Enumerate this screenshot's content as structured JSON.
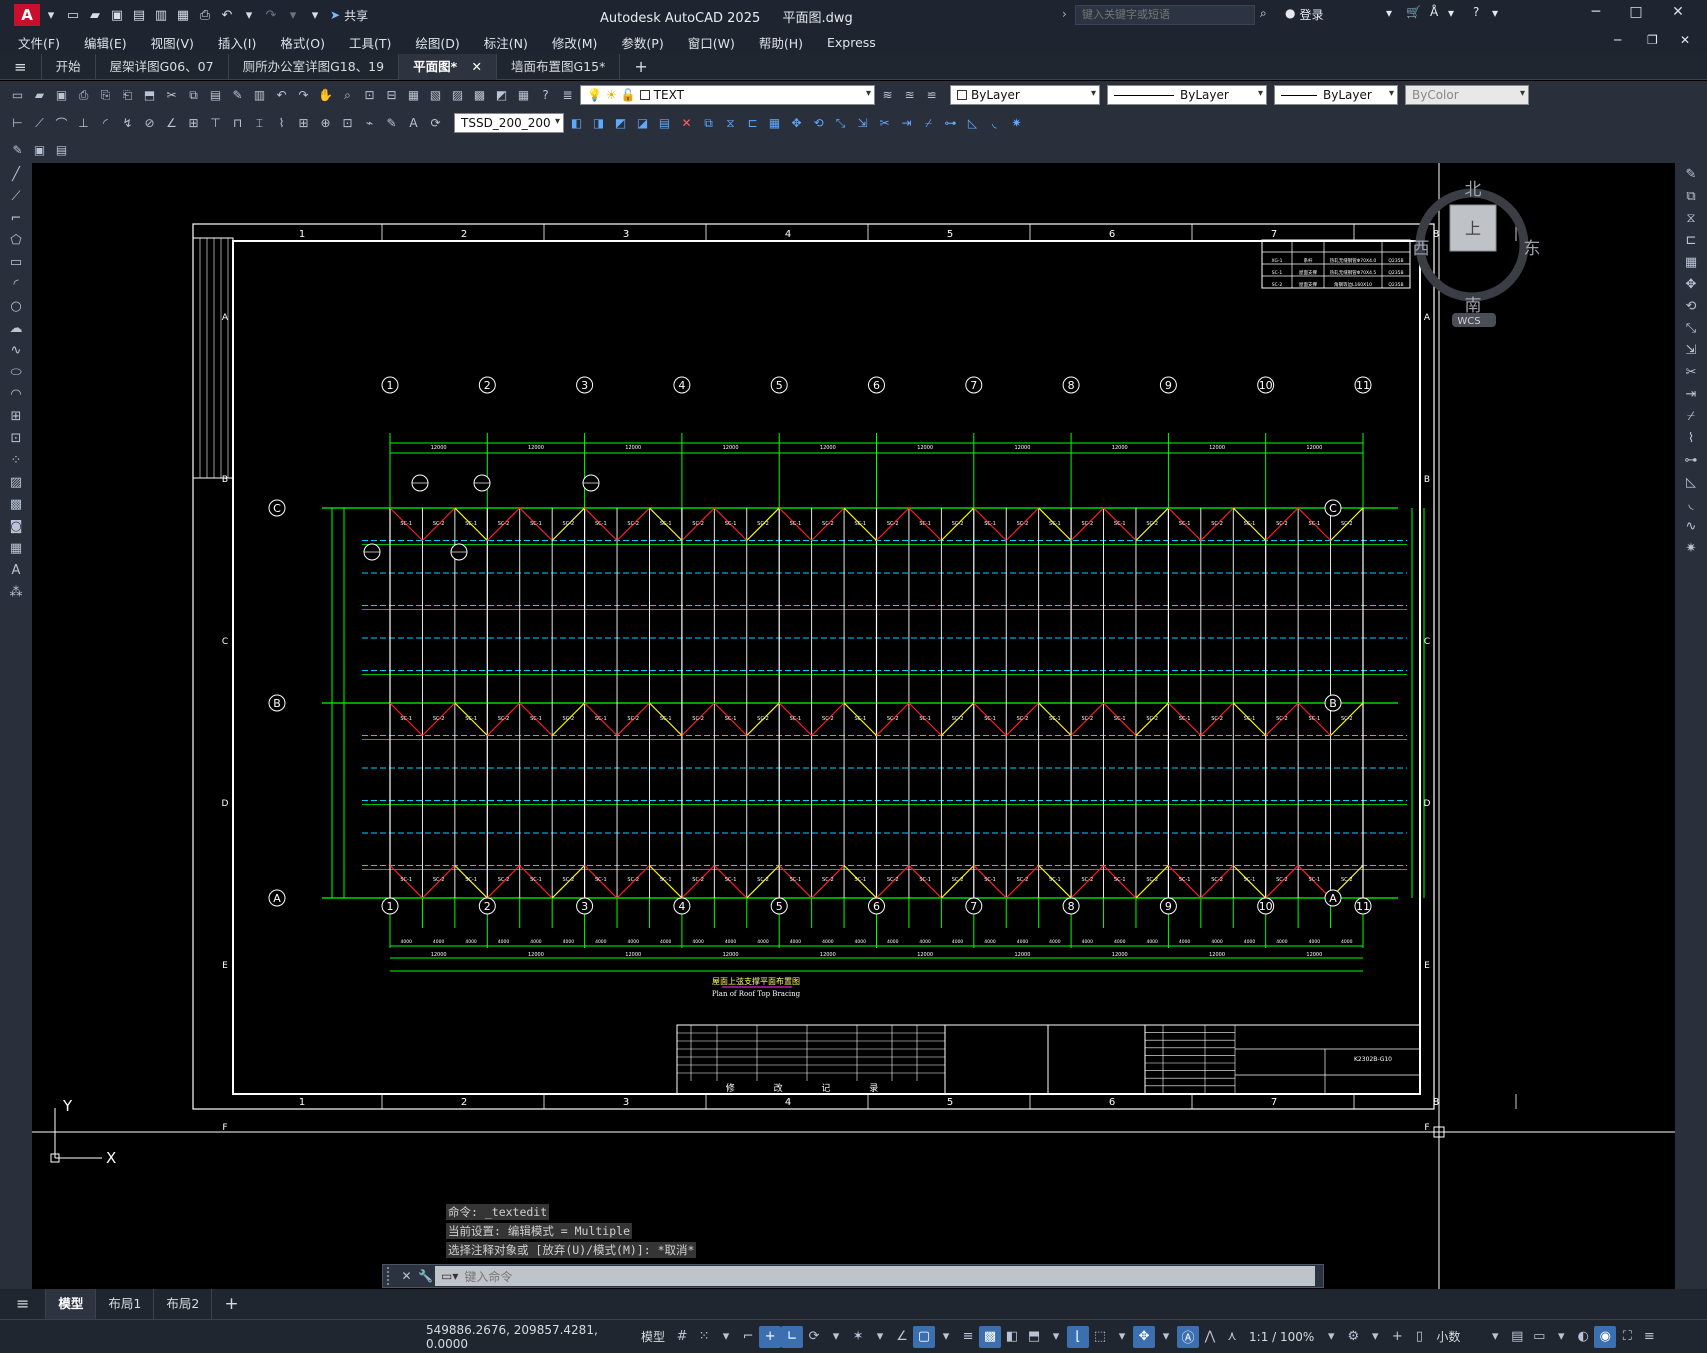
{
  "app": {
    "product": "Autodesk AutoCAD 2025",
    "filename": "平面图.dwg",
    "search_placeholder": "键入关键字或短语",
    "login": "登录",
    "share": "共享"
  },
  "menus": [
    "文件(F)",
    "编辑(E)",
    "视图(V)",
    "插入(I)",
    "格式(O)",
    "工具(T)",
    "绘图(D)",
    "标注(N)",
    "修改(M)",
    "参数(P)",
    "窗口(W)",
    "帮助(H)",
    "Express"
  ],
  "file_tabs": [
    {
      "label": "开始"
    },
    {
      "label": "屋架详图G06、07"
    },
    {
      "label": "厕所办公室详图G18、19"
    },
    {
      "label": "平面图*",
      "active": true
    },
    {
      "label": "墙面布置图G15*"
    }
  ],
  "props": {
    "layer": "TEXT",
    "color": "ByLayer",
    "linetype": "ByLayer",
    "lineweight": "ByLayer",
    "plotstyle": "ByColor",
    "dimstyle": "TSSD_200_200"
  },
  "viewcube": {
    "north": "北",
    "south": "南",
    "east": "东",
    "west": "西",
    "top": "上",
    "wcs": "WCS"
  },
  "drawing": {
    "col_labels": [
      "1",
      "2",
      "3",
      "4",
      "5",
      "6",
      "7",
      "8",
      "9",
      "10",
      "11"
    ],
    "row_labels": [
      "C",
      "B",
      "A"
    ],
    "frame_top_numbers": [
      "1",
      "2",
      "3",
      "4",
      "5",
      "6",
      "7",
      "8"
    ],
    "frame_side_letters": [
      "A",
      "B",
      "C",
      "D",
      "E",
      "F"
    ],
    "caption_cn": "屋面上弦支撑平面布置图",
    "caption_en": "Plan of Roof Top Bracing",
    "revision_label": "修 改 记 录",
    "sheet_no": "K2302B-G10",
    "span_dim": "12000",
    "bay_dim": "6000",
    "sub_dim": "4000",
    "brace_labels": [
      "SC-1",
      "SC-2"
    ],
    "legend_rows": [
      [
        "XG-1",
        "系杆",
        "热轧无缝钢管Φ70X4.0",
        "Q235B"
      ],
      [
        "SC-1",
        "屋面支撑",
        "热轧无缝钢管Φ70X4.5",
        "Q235B"
      ],
      [
        "SC-2",
        "屋面支撑",
        "角钢等边L160X10",
        "Q235B"
      ]
    ]
  },
  "command": {
    "history": [
      "命令: _textedit",
      "当前设置: 编辑模式 = Multiple",
      "选择注释对象或 [放弃(U)/模式(M)]: *取消*"
    ],
    "placeholder": "键入命令"
  },
  "layout_tabs": [
    {
      "label": "模型",
      "active": true
    },
    {
      "label": "布局1"
    },
    {
      "label": "布局2"
    }
  ],
  "status": {
    "coords": "549886.2676, 209857.4281, 0.0000",
    "mode": "模型",
    "scale": "1:1 / 100%",
    "units": "小数"
  },
  "colors": {
    "accent": "#3b6fb0",
    "bg_dark": "#20262f",
    "grid_green": "#00ff00",
    "purlin_cyan": "#00d0ff",
    "brace_red": "#ff2020",
    "brace_yellow": "#ffff00"
  }
}
